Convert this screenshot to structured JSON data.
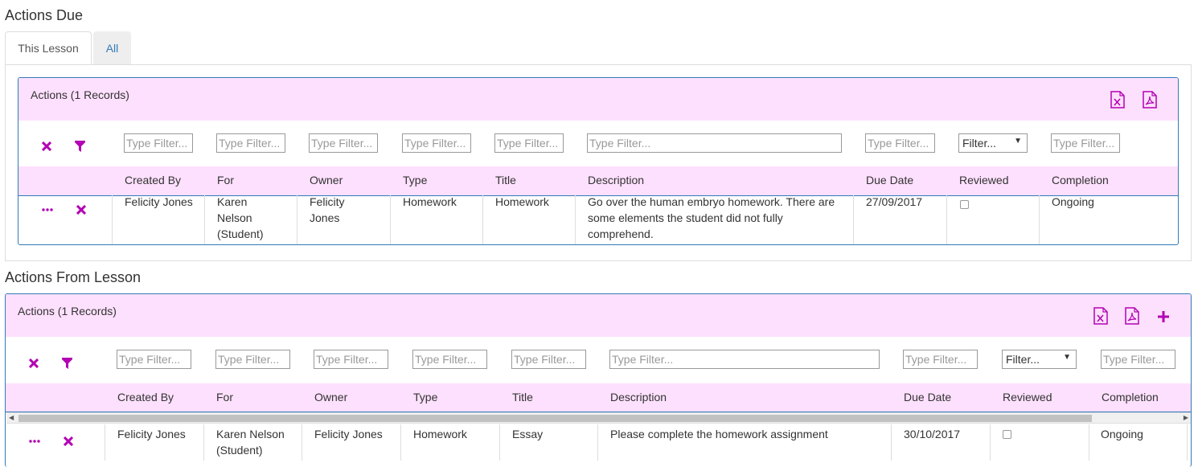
{
  "actions_due": {
    "title": "Actions Due",
    "tabs": [
      {
        "label": "This Lesson"
      },
      {
        "label": "All"
      }
    ],
    "panel": {
      "title": "Actions (1 Records)",
      "filters": {
        "placeholder": "Type Filter...",
        "select_value": "Filter..."
      },
      "columns": [
        "Created By",
        "For",
        "Owner",
        "Type",
        "Title",
        "Description",
        "Due Date",
        "Reviewed",
        "Completion"
      ],
      "rows": [
        {
          "created_by": "Felicity Jones",
          "for": "Karen Nelson (Student)",
          "owner": "Felicity Jones",
          "type": "Homework",
          "title": "Homework",
          "description": "Go over the human embryo homework. There are some elements the student did not fully comprehend.",
          "due_date": "27/09/2017",
          "reviewed": false,
          "completion": "Ongoing"
        }
      ]
    }
  },
  "actions_from_lesson": {
    "title": "Actions From Lesson",
    "panel": {
      "title": "Actions (1 Records)",
      "filters": {
        "placeholder": "Type Filter...",
        "select_value": "Filter..."
      },
      "columns": [
        "Created By",
        "For",
        "Owner",
        "Type",
        "Title",
        "Description",
        "Due Date",
        "Reviewed",
        "Completion"
      ],
      "rows": [
        {
          "created_by": "Felicity Jones",
          "for": "Karen Nelson (Student)",
          "owner": "Felicity Jones",
          "type": "Homework",
          "title": "Essay",
          "description": "Please complete the homework assignment",
          "due_date": "30/10/2017",
          "reviewed": false,
          "completion": "Ongoing"
        }
      ]
    }
  },
  "icons": {
    "excel": "excel-export-icon",
    "pdf": "pdf-export-icon",
    "add": "plus-icon",
    "clear": "clear-filter-icon",
    "filter": "funnel-icon",
    "more": "more-options-icon",
    "delete": "delete-icon"
  },
  "colors": {
    "accent": "#b300b3",
    "header_bg": "#fde0fd",
    "border": "#337ab7"
  }
}
